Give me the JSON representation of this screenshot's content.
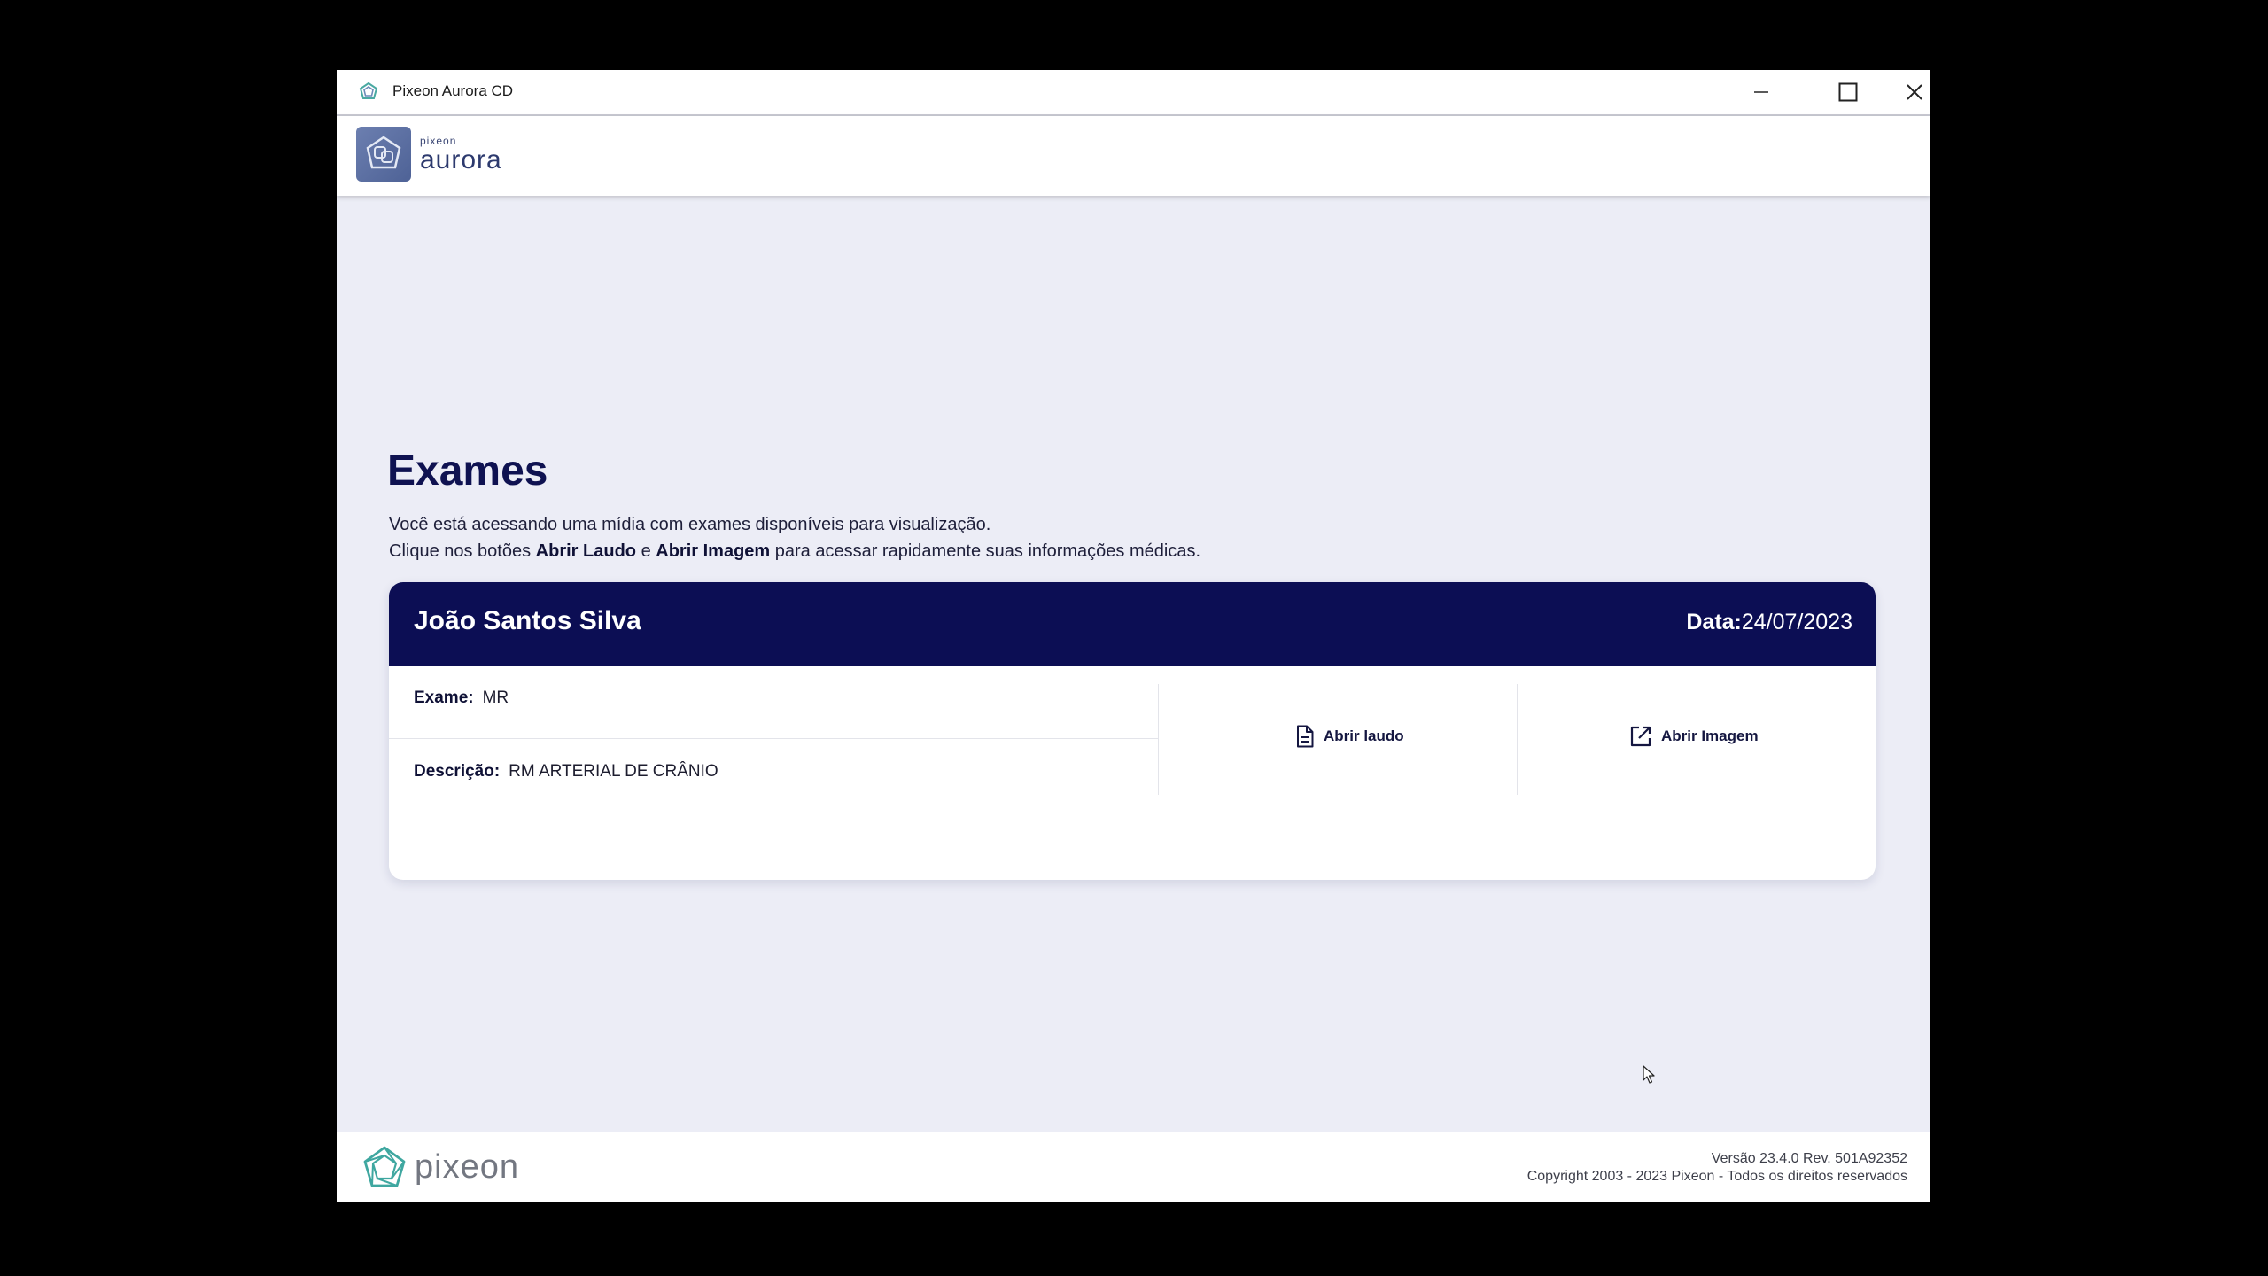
{
  "window": {
    "title": "Pixeon Aurora CD",
    "controls": [
      "minimize",
      "maximize",
      "close"
    ]
  },
  "header": {
    "logo_small": "PIXEON",
    "logo_big": "AURORA"
  },
  "main": {
    "title": "Exames",
    "intro_line1": "Você está acessando uma mídia com exames disponíveis para visualização.",
    "intro_line2_prefix": "Clique nos botões ",
    "intro_line2_bold1": "Abrir Laudo",
    "intro_line2_mid": " e ",
    "intro_line2_bold2": "Abrir Imagem",
    "intro_line2_suffix": " para acessar rapidamente suas informações médicas."
  },
  "exam_card": {
    "patient_name": "João Santos Silva",
    "date_label": "Data:",
    "date_value": "24/07/2023",
    "exam_label": "Exame:",
    "exam_value": "MR",
    "description_label": "Descrição:",
    "description_value": "RM ARTERIAL DE CRÂNIO",
    "open_report_label": "Abrir laudo",
    "open_image_label": "Abrir Imagem"
  },
  "footer": {
    "logo_text": "PIXEON",
    "version": "Versão 23.4.0 Rev. 501A92352",
    "copyright": "Copyright 2003 - 2023 Pixeon - Todos os direitos reservados"
  },
  "colors": {
    "primary_navy": "#0c0e54",
    "background": "#ecedf6",
    "brand_teal": "#3fa7a0"
  }
}
